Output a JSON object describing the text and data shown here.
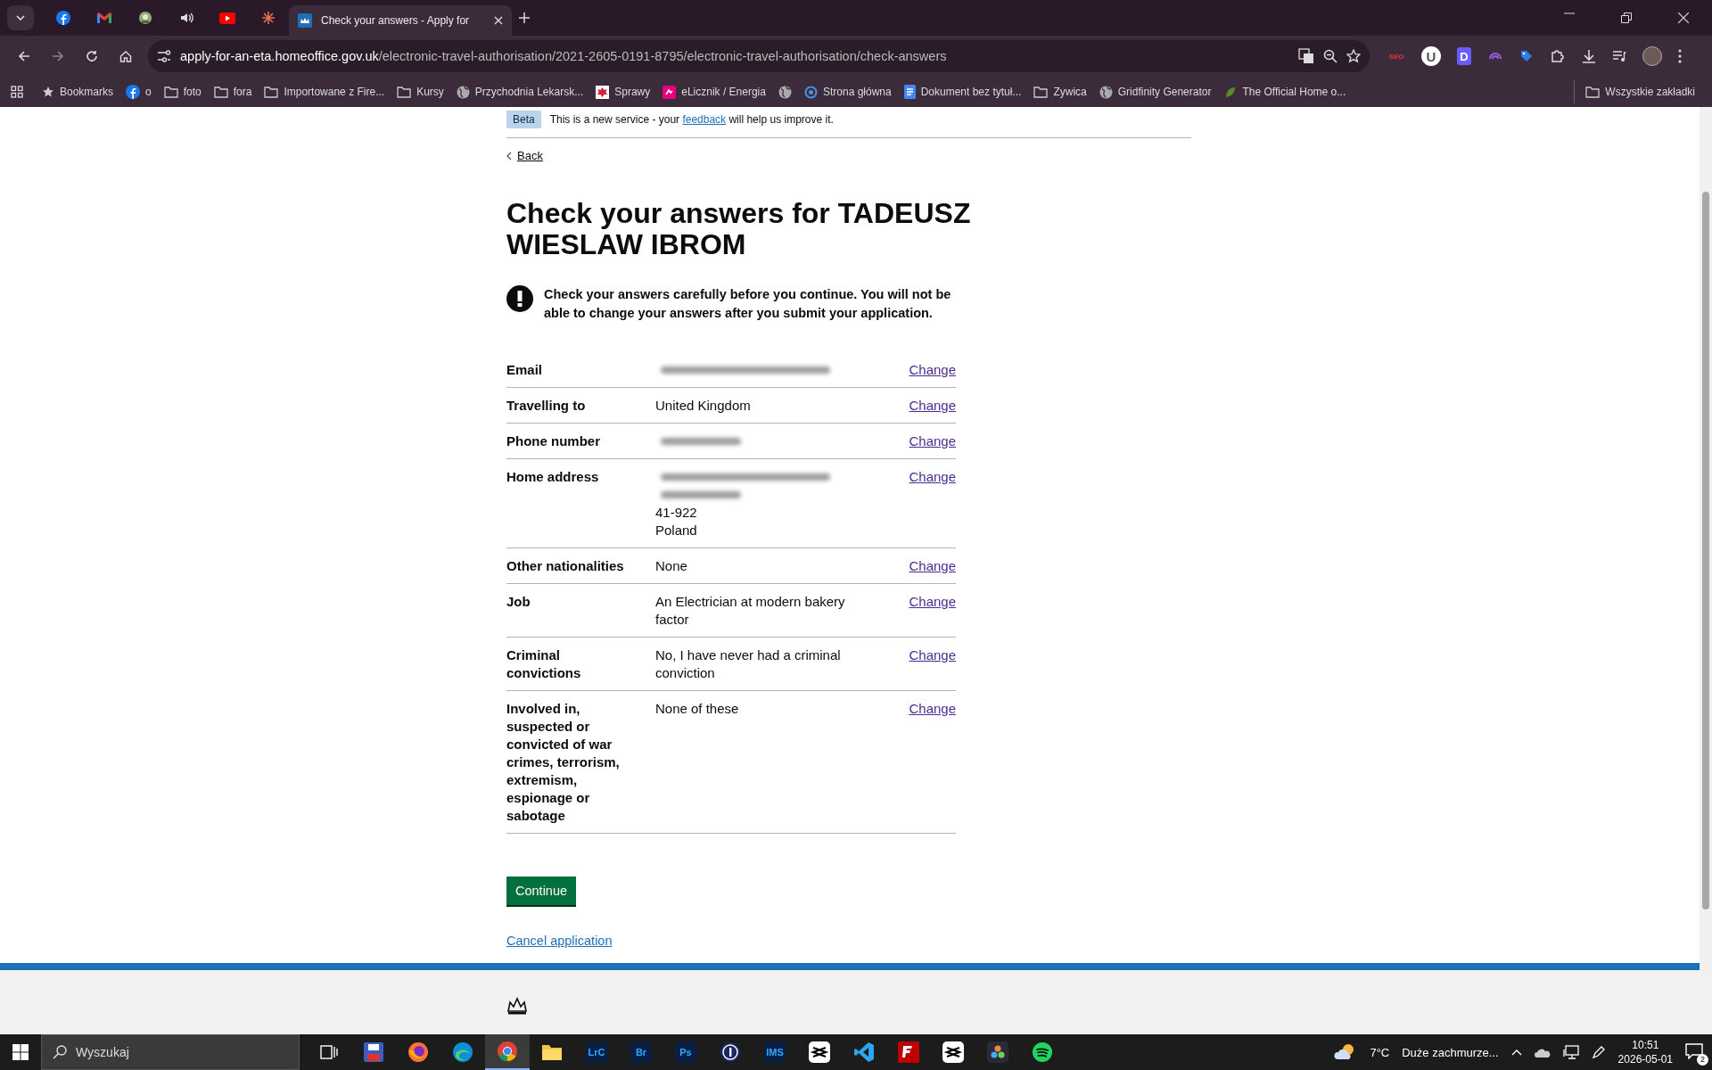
{
  "browser": {
    "tabs": [
      {
        "kind": "facebook",
        "selected": false
      },
      {
        "kind": "mail",
        "selected": false
      },
      {
        "kind": "badge",
        "selected": false
      },
      {
        "kind": "sound",
        "selected": false
      },
      {
        "kind": "video",
        "selected": false
      },
      {
        "kind": "sunburst",
        "selected": false
      },
      {
        "kind": "page",
        "title": "Check your answers - Apply for",
        "selected": true
      }
    ],
    "address": {
      "host": "apply-for-an-eta.homeoffice.gov.uk",
      "path": "/electronic-travel-authorisation/2021-2605-0191-8795/electronic-travel-authorisation/check-answers"
    },
    "extensions": [
      {
        "kind": "seo",
        "label": "SEO"
      },
      {
        "kind": "circle",
        "label": "U"
      },
      {
        "kind": "square",
        "label": "D"
      },
      {
        "kind": "wave"
      },
      {
        "kind": "tag"
      },
      {
        "kind": "puzzle"
      }
    ],
    "bookmarks": [
      {
        "kind": "star",
        "label": "Bookmarks"
      },
      {
        "kind": "facebook",
        "label": "o"
      },
      {
        "kind": "folder",
        "label": "foto"
      },
      {
        "kind": "folder",
        "label": "fora"
      },
      {
        "kind": "folder",
        "label": "Importowane z Fire..."
      },
      {
        "kind": "folder",
        "label": "Kursy"
      },
      {
        "kind": "globe",
        "label": "Przychodnia Lekarsk..."
      },
      {
        "kind": "eagle",
        "label": "Sprawy"
      },
      {
        "kind": "meter",
        "label": "eLicznik / Energia"
      },
      {
        "kind": "globe"
      },
      {
        "kind": "ring",
        "label": "Strona główna"
      },
      {
        "kind": "doc",
        "label": "Dokument bez tytuł..."
      },
      {
        "kind": "folder",
        "label": "Zywica"
      },
      {
        "kind": "globe",
        "label": "Gridfinity Generator"
      },
      {
        "kind": "leaf",
        "label": "The Official Home o..."
      }
    ],
    "all_bookmarks": "Wszystkie zakładki"
  },
  "page": {
    "phase_banner": {
      "tag": "Beta",
      "text": "This is a new service - your ",
      "link": "feedback",
      "text_after": " will help us improve it."
    },
    "back_link": "Back",
    "heading": "Check your answers for TADEUSZ WIESLAW IBROM",
    "warning": "Check your answers carefully before you continue. You will not be able to change your answers after you submit your application.",
    "rows": [
      {
        "key": "Email",
        "value": [
          {
            "kind": "blurred"
          }
        ],
        "action": "Change"
      },
      {
        "key": "Travelling to",
        "value": [
          {
            "kind": "text",
            "text": "United Kingdom"
          }
        ],
        "action": "Change"
      },
      {
        "key": "Phone number",
        "value": [
          {
            "kind": "blurred",
            "short": true
          }
        ],
        "action": "Change"
      },
      {
        "key": "Home address",
        "value": [
          {
            "kind": "blurred"
          },
          {
            "kind": "blurred",
            "short": true
          },
          {
            "kind": "text",
            "text": "41-922"
          },
          {
            "kind": "text",
            "text": "Poland"
          }
        ],
        "action": "Change"
      },
      {
        "key": "Other nationalities",
        "value": [
          {
            "kind": "text",
            "text": "None"
          }
        ],
        "action": "Change"
      },
      {
        "key": "Job",
        "value": [
          {
            "kind": "text",
            "text": "An Electrician at modern bakery factor"
          }
        ],
        "action": "Change"
      },
      {
        "key": "Criminal convictions",
        "value": [
          {
            "kind": "text",
            "text": "No, I have never had a criminal conviction"
          }
        ],
        "action": "Change"
      },
      {
        "key": "Involved in, suspected or convicted of war crimes, terrorism, extremism, espionage or sabotage",
        "value": [
          {
            "kind": "text",
            "text": "None of these"
          }
        ],
        "action": "Change"
      }
    ],
    "continue_button": "Continue",
    "cancel_link": "Cancel application"
  },
  "taskbar": {
    "search_placeholder": "Wyszukaj",
    "apps": [
      {
        "kind": "taskview",
        "selected": false
      },
      {
        "kind": "floppy",
        "selected": false
      },
      {
        "kind": "firefox",
        "selected": false
      },
      {
        "kind": "edge",
        "selected": false
      },
      {
        "kind": "chrome",
        "selected": true
      },
      {
        "kind": "explorer",
        "selected": false
      },
      {
        "kind": "tile",
        "label": "LrC",
        "selected": false
      },
      {
        "kind": "tile",
        "label": "Br",
        "selected": false
      },
      {
        "kind": "tile",
        "label": "Ps",
        "selected": false
      },
      {
        "kind": "onepass",
        "selected": false
      },
      {
        "kind": "tile",
        "label": "IMS",
        "selected": false
      },
      {
        "kind": "capcut",
        "selected": false
      },
      {
        "kind": "vscode",
        "selected": false
      },
      {
        "kind": "filezilla",
        "selected": false
      },
      {
        "kind": "capcut",
        "selected": false
      },
      {
        "kind": "resolve",
        "selected": false
      },
      {
        "kind": "spotify",
        "selected": false
      }
    ],
    "weather": {
      "temperature": "7°C",
      "condition": "Duże zachmurze..."
    },
    "time": "10:51",
    "date": "2026-05-01",
    "notifications": "2"
  }
}
